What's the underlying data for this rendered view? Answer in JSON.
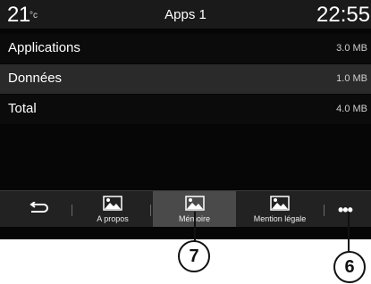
{
  "status": {
    "temperature": "21",
    "temperature_unit": "°c",
    "title": "Apps 1",
    "time": "22:55"
  },
  "rows": [
    {
      "label": "Applications",
      "value": "3.0 MB"
    },
    {
      "label": "Données",
      "value": "1.0 MB"
    },
    {
      "label": "Total",
      "value": "4.0 MB"
    }
  ],
  "tabs": {
    "about_label": "A propos",
    "memory_label": "Mémoire",
    "legal_label": "Mention légale"
  },
  "icons": {
    "back": "back-arrow-icon",
    "image": "image-icon",
    "more": "more-options-icon"
  },
  "callouts": {
    "memory": "7",
    "more": "6"
  },
  "colors": {
    "screen_bg": "#060606",
    "status_bar_bg": "#1a1a1a",
    "row_highlight": "#2a2a2a",
    "tab_selected": "#4a4a4a"
  }
}
